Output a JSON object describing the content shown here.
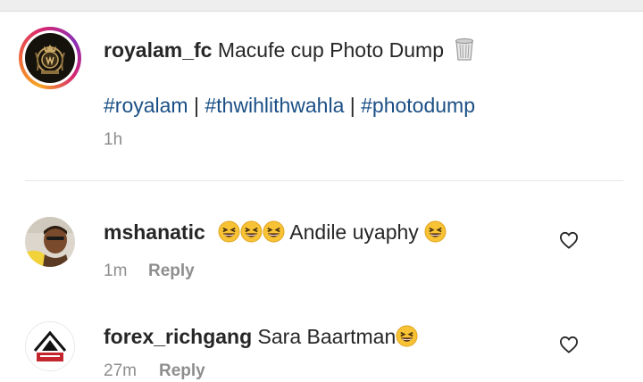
{
  "caption": {
    "username": "royalam_fc",
    "text": "Macufe cup Photo Dump",
    "hashtags": [
      "#royalam",
      "#thwihlithwahla",
      "#photodump"
    ],
    "separator": "|",
    "time": "1h"
  },
  "comments": [
    {
      "username": "mshanatic",
      "text": "Andile uyaphy",
      "time": "1m",
      "reply_label": "Reply"
    },
    {
      "username": "forex_richgang",
      "text": "Sara Baartman",
      "time": "27m",
      "reply_label": "Reply"
    }
  ],
  "icons": {
    "caption_emoji": "wastebasket-icon",
    "comment_emoji": "grinning-squinting-face-icon",
    "like": "heart-outline-icon"
  },
  "colors": {
    "hashtag": "#1b4f86",
    "meta": "#8e8e8e",
    "text": "#262626"
  }
}
